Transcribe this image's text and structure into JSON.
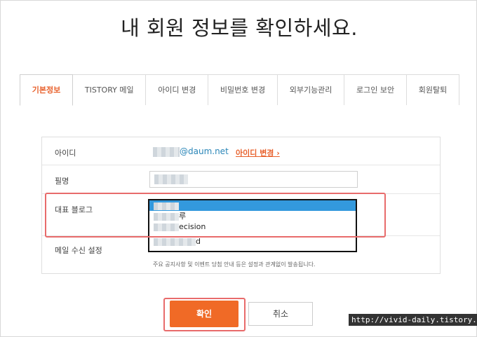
{
  "page": {
    "title": "내 회원 정보를 확인하세요."
  },
  "tabs": [
    {
      "label": "기본정보",
      "active": true
    },
    {
      "label": "TISTORY 메일",
      "active": false
    },
    {
      "label": "아이디 변경",
      "active": false
    },
    {
      "label": "비밀번호 변경",
      "active": false
    },
    {
      "label": "외부기능관리",
      "active": false
    },
    {
      "label": "로그인 보안",
      "active": false
    },
    {
      "label": "회원탈퇴",
      "active": false
    }
  ],
  "form": {
    "id_label": "아이디",
    "id_value": "@daum.net",
    "id_change_link": "아이디 변경 ›",
    "nickname_label": "필명",
    "blog_label": "대표 블로그",
    "blog_options": [
      "",
      "루",
      "ecision",
      "d"
    ],
    "mail_label": "메일 수신 설정",
    "mail_note": "주요 공지사항 및 이벤트 당첨 안내 등은 설정과 관계없이 발송됩니다."
  },
  "buttons": {
    "confirm": "확인",
    "cancel": "취소"
  },
  "watermark": "http://vivid-daily.tistory.com",
  "colors": {
    "accent": "#f06a26",
    "highlight": "#e86b6b",
    "selected": "#3399dd"
  }
}
